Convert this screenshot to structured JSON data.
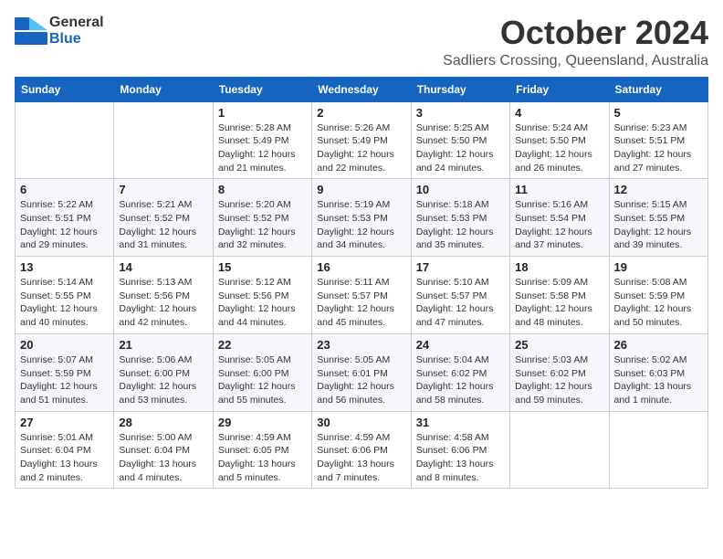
{
  "logo": {
    "line1": "General",
    "line2": "Blue"
  },
  "title": "October 2024",
  "subtitle": "Sadliers Crossing, Queensland, Australia",
  "weekdays": [
    "Sunday",
    "Monday",
    "Tuesday",
    "Wednesday",
    "Thursday",
    "Friday",
    "Saturday"
  ],
  "weeks": [
    [
      {
        "day": "",
        "detail": ""
      },
      {
        "day": "",
        "detail": ""
      },
      {
        "day": "1",
        "detail": "Sunrise: 5:28 AM\nSunset: 5:49 PM\nDaylight: 12 hours and 21 minutes."
      },
      {
        "day": "2",
        "detail": "Sunrise: 5:26 AM\nSunset: 5:49 PM\nDaylight: 12 hours and 22 minutes."
      },
      {
        "day": "3",
        "detail": "Sunrise: 5:25 AM\nSunset: 5:50 PM\nDaylight: 12 hours and 24 minutes."
      },
      {
        "day": "4",
        "detail": "Sunrise: 5:24 AM\nSunset: 5:50 PM\nDaylight: 12 hours and 26 minutes."
      },
      {
        "day": "5",
        "detail": "Sunrise: 5:23 AM\nSunset: 5:51 PM\nDaylight: 12 hours and 27 minutes."
      }
    ],
    [
      {
        "day": "6",
        "detail": "Sunrise: 5:22 AM\nSunset: 5:51 PM\nDaylight: 12 hours and 29 minutes."
      },
      {
        "day": "7",
        "detail": "Sunrise: 5:21 AM\nSunset: 5:52 PM\nDaylight: 12 hours and 31 minutes."
      },
      {
        "day": "8",
        "detail": "Sunrise: 5:20 AM\nSunset: 5:52 PM\nDaylight: 12 hours and 32 minutes."
      },
      {
        "day": "9",
        "detail": "Sunrise: 5:19 AM\nSunset: 5:53 PM\nDaylight: 12 hours and 34 minutes."
      },
      {
        "day": "10",
        "detail": "Sunrise: 5:18 AM\nSunset: 5:53 PM\nDaylight: 12 hours and 35 minutes."
      },
      {
        "day": "11",
        "detail": "Sunrise: 5:16 AM\nSunset: 5:54 PM\nDaylight: 12 hours and 37 minutes."
      },
      {
        "day": "12",
        "detail": "Sunrise: 5:15 AM\nSunset: 5:55 PM\nDaylight: 12 hours and 39 minutes."
      }
    ],
    [
      {
        "day": "13",
        "detail": "Sunrise: 5:14 AM\nSunset: 5:55 PM\nDaylight: 12 hours and 40 minutes."
      },
      {
        "day": "14",
        "detail": "Sunrise: 5:13 AM\nSunset: 5:56 PM\nDaylight: 12 hours and 42 minutes."
      },
      {
        "day": "15",
        "detail": "Sunrise: 5:12 AM\nSunset: 5:56 PM\nDaylight: 12 hours and 44 minutes."
      },
      {
        "day": "16",
        "detail": "Sunrise: 5:11 AM\nSunset: 5:57 PM\nDaylight: 12 hours and 45 minutes."
      },
      {
        "day": "17",
        "detail": "Sunrise: 5:10 AM\nSunset: 5:57 PM\nDaylight: 12 hours and 47 minutes."
      },
      {
        "day": "18",
        "detail": "Sunrise: 5:09 AM\nSunset: 5:58 PM\nDaylight: 12 hours and 48 minutes."
      },
      {
        "day": "19",
        "detail": "Sunrise: 5:08 AM\nSunset: 5:59 PM\nDaylight: 12 hours and 50 minutes."
      }
    ],
    [
      {
        "day": "20",
        "detail": "Sunrise: 5:07 AM\nSunset: 5:59 PM\nDaylight: 12 hours and 51 minutes."
      },
      {
        "day": "21",
        "detail": "Sunrise: 5:06 AM\nSunset: 6:00 PM\nDaylight: 12 hours and 53 minutes."
      },
      {
        "day": "22",
        "detail": "Sunrise: 5:05 AM\nSunset: 6:00 PM\nDaylight: 12 hours and 55 minutes."
      },
      {
        "day": "23",
        "detail": "Sunrise: 5:05 AM\nSunset: 6:01 PM\nDaylight: 12 hours and 56 minutes."
      },
      {
        "day": "24",
        "detail": "Sunrise: 5:04 AM\nSunset: 6:02 PM\nDaylight: 12 hours and 58 minutes."
      },
      {
        "day": "25",
        "detail": "Sunrise: 5:03 AM\nSunset: 6:02 PM\nDaylight: 12 hours and 59 minutes."
      },
      {
        "day": "26",
        "detail": "Sunrise: 5:02 AM\nSunset: 6:03 PM\nDaylight: 13 hours and 1 minute."
      }
    ],
    [
      {
        "day": "27",
        "detail": "Sunrise: 5:01 AM\nSunset: 6:04 PM\nDaylight: 13 hours and 2 minutes."
      },
      {
        "day": "28",
        "detail": "Sunrise: 5:00 AM\nSunset: 6:04 PM\nDaylight: 13 hours and 4 minutes."
      },
      {
        "day": "29",
        "detail": "Sunrise: 4:59 AM\nSunset: 6:05 PM\nDaylight: 13 hours and 5 minutes."
      },
      {
        "day": "30",
        "detail": "Sunrise: 4:59 AM\nSunset: 6:06 PM\nDaylight: 13 hours and 7 minutes."
      },
      {
        "day": "31",
        "detail": "Sunrise: 4:58 AM\nSunset: 6:06 PM\nDaylight: 13 hours and 8 minutes."
      },
      {
        "day": "",
        "detail": ""
      },
      {
        "day": "",
        "detail": ""
      }
    ]
  ]
}
